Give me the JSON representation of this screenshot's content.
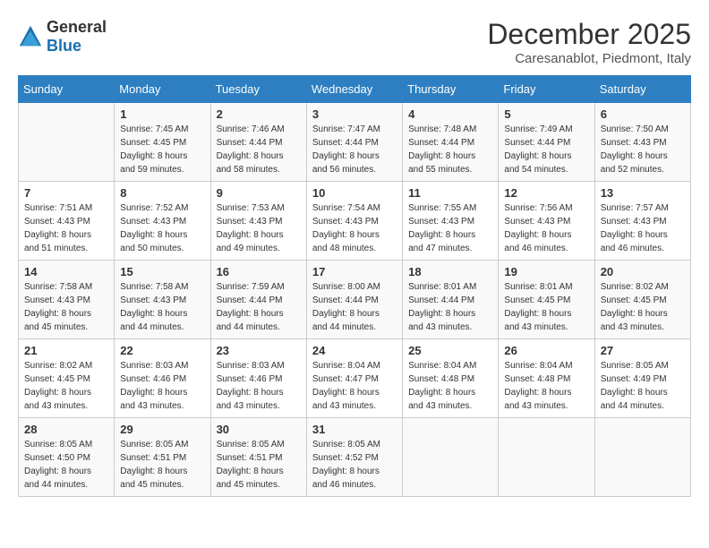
{
  "logo": {
    "general": "General",
    "blue": "Blue"
  },
  "title": "December 2025",
  "location": "Caresanablot, Piedmont, Italy",
  "days_of_week": [
    "Sunday",
    "Monday",
    "Tuesday",
    "Wednesday",
    "Thursday",
    "Friday",
    "Saturday"
  ],
  "weeks": [
    [
      {
        "day": "",
        "sunrise": "",
        "sunset": "",
        "daylight": ""
      },
      {
        "day": "1",
        "sunrise": "Sunrise: 7:45 AM",
        "sunset": "Sunset: 4:45 PM",
        "daylight": "Daylight: 8 hours and 59 minutes."
      },
      {
        "day": "2",
        "sunrise": "Sunrise: 7:46 AM",
        "sunset": "Sunset: 4:44 PM",
        "daylight": "Daylight: 8 hours and 58 minutes."
      },
      {
        "day": "3",
        "sunrise": "Sunrise: 7:47 AM",
        "sunset": "Sunset: 4:44 PM",
        "daylight": "Daylight: 8 hours and 56 minutes."
      },
      {
        "day": "4",
        "sunrise": "Sunrise: 7:48 AM",
        "sunset": "Sunset: 4:44 PM",
        "daylight": "Daylight: 8 hours and 55 minutes."
      },
      {
        "day": "5",
        "sunrise": "Sunrise: 7:49 AM",
        "sunset": "Sunset: 4:44 PM",
        "daylight": "Daylight: 8 hours and 54 minutes."
      },
      {
        "day": "6",
        "sunrise": "Sunrise: 7:50 AM",
        "sunset": "Sunset: 4:43 PM",
        "daylight": "Daylight: 8 hours and 52 minutes."
      }
    ],
    [
      {
        "day": "7",
        "sunrise": "Sunrise: 7:51 AM",
        "sunset": "Sunset: 4:43 PM",
        "daylight": "Daylight: 8 hours and 51 minutes."
      },
      {
        "day": "8",
        "sunrise": "Sunrise: 7:52 AM",
        "sunset": "Sunset: 4:43 PM",
        "daylight": "Daylight: 8 hours and 50 minutes."
      },
      {
        "day": "9",
        "sunrise": "Sunrise: 7:53 AM",
        "sunset": "Sunset: 4:43 PM",
        "daylight": "Daylight: 8 hours and 49 minutes."
      },
      {
        "day": "10",
        "sunrise": "Sunrise: 7:54 AM",
        "sunset": "Sunset: 4:43 PM",
        "daylight": "Daylight: 8 hours and 48 minutes."
      },
      {
        "day": "11",
        "sunrise": "Sunrise: 7:55 AM",
        "sunset": "Sunset: 4:43 PM",
        "daylight": "Daylight: 8 hours and 47 minutes."
      },
      {
        "day": "12",
        "sunrise": "Sunrise: 7:56 AM",
        "sunset": "Sunset: 4:43 PM",
        "daylight": "Daylight: 8 hours and 46 minutes."
      },
      {
        "day": "13",
        "sunrise": "Sunrise: 7:57 AM",
        "sunset": "Sunset: 4:43 PM",
        "daylight": "Daylight: 8 hours and 46 minutes."
      }
    ],
    [
      {
        "day": "14",
        "sunrise": "Sunrise: 7:58 AM",
        "sunset": "Sunset: 4:43 PM",
        "daylight": "Daylight: 8 hours and 45 minutes."
      },
      {
        "day": "15",
        "sunrise": "Sunrise: 7:58 AM",
        "sunset": "Sunset: 4:43 PM",
        "daylight": "Daylight: 8 hours and 44 minutes."
      },
      {
        "day": "16",
        "sunrise": "Sunrise: 7:59 AM",
        "sunset": "Sunset: 4:44 PM",
        "daylight": "Daylight: 8 hours and 44 minutes."
      },
      {
        "day": "17",
        "sunrise": "Sunrise: 8:00 AM",
        "sunset": "Sunset: 4:44 PM",
        "daylight": "Daylight: 8 hours and 44 minutes."
      },
      {
        "day": "18",
        "sunrise": "Sunrise: 8:01 AM",
        "sunset": "Sunset: 4:44 PM",
        "daylight": "Daylight: 8 hours and 43 minutes."
      },
      {
        "day": "19",
        "sunrise": "Sunrise: 8:01 AM",
        "sunset": "Sunset: 4:45 PM",
        "daylight": "Daylight: 8 hours and 43 minutes."
      },
      {
        "day": "20",
        "sunrise": "Sunrise: 8:02 AM",
        "sunset": "Sunset: 4:45 PM",
        "daylight": "Daylight: 8 hours and 43 minutes."
      }
    ],
    [
      {
        "day": "21",
        "sunrise": "Sunrise: 8:02 AM",
        "sunset": "Sunset: 4:45 PM",
        "daylight": "Daylight: 8 hours and 43 minutes."
      },
      {
        "day": "22",
        "sunrise": "Sunrise: 8:03 AM",
        "sunset": "Sunset: 4:46 PM",
        "daylight": "Daylight: 8 hours and 43 minutes."
      },
      {
        "day": "23",
        "sunrise": "Sunrise: 8:03 AM",
        "sunset": "Sunset: 4:46 PM",
        "daylight": "Daylight: 8 hours and 43 minutes."
      },
      {
        "day": "24",
        "sunrise": "Sunrise: 8:04 AM",
        "sunset": "Sunset: 4:47 PM",
        "daylight": "Daylight: 8 hours and 43 minutes."
      },
      {
        "day": "25",
        "sunrise": "Sunrise: 8:04 AM",
        "sunset": "Sunset: 4:48 PM",
        "daylight": "Daylight: 8 hours and 43 minutes."
      },
      {
        "day": "26",
        "sunrise": "Sunrise: 8:04 AM",
        "sunset": "Sunset: 4:48 PM",
        "daylight": "Daylight: 8 hours and 43 minutes."
      },
      {
        "day": "27",
        "sunrise": "Sunrise: 8:05 AM",
        "sunset": "Sunset: 4:49 PM",
        "daylight": "Daylight: 8 hours and 44 minutes."
      }
    ],
    [
      {
        "day": "28",
        "sunrise": "Sunrise: 8:05 AM",
        "sunset": "Sunset: 4:50 PM",
        "daylight": "Daylight: 8 hours and 44 minutes."
      },
      {
        "day": "29",
        "sunrise": "Sunrise: 8:05 AM",
        "sunset": "Sunset: 4:51 PM",
        "daylight": "Daylight: 8 hours and 45 minutes."
      },
      {
        "day": "30",
        "sunrise": "Sunrise: 8:05 AM",
        "sunset": "Sunset: 4:51 PM",
        "daylight": "Daylight: 8 hours and 45 minutes."
      },
      {
        "day": "31",
        "sunrise": "Sunrise: 8:05 AM",
        "sunset": "Sunset: 4:52 PM",
        "daylight": "Daylight: 8 hours and 46 minutes."
      },
      {
        "day": "",
        "sunrise": "",
        "sunset": "",
        "daylight": ""
      },
      {
        "day": "",
        "sunrise": "",
        "sunset": "",
        "daylight": ""
      },
      {
        "day": "",
        "sunrise": "",
        "sunset": "",
        "daylight": ""
      }
    ]
  ]
}
